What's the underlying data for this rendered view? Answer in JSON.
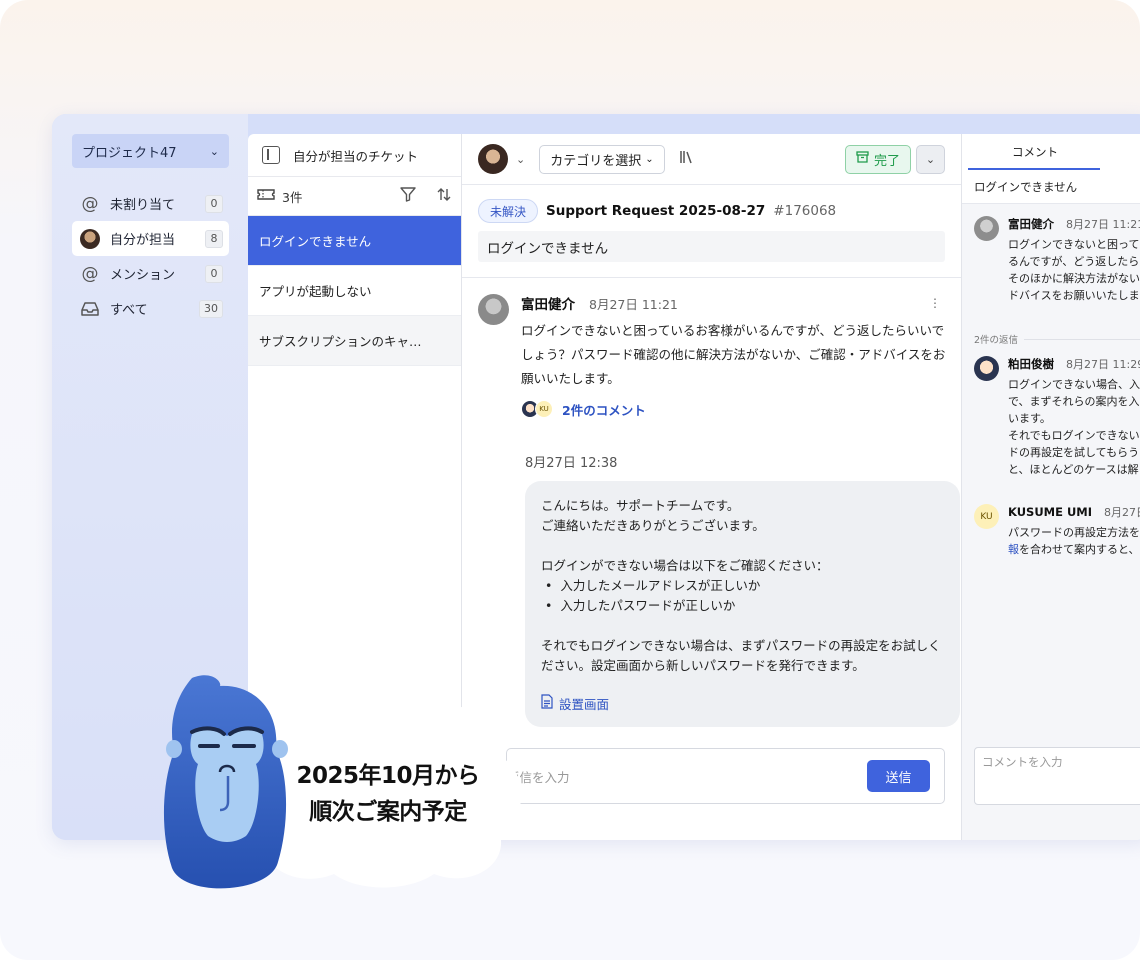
{
  "sidebar": {
    "project": "プロジェクト47",
    "items": [
      {
        "icon": "at-icon",
        "label": "未割り当て",
        "count": "0"
      },
      {
        "icon": "avatar",
        "label": "自分が担当",
        "count": "8"
      },
      {
        "icon": "at-icon",
        "label": "メンション",
        "count": "0"
      },
      {
        "icon": "inbox-icon",
        "label": "すべて",
        "count": "30"
      }
    ]
  },
  "ticket_list": {
    "header": "自分が担当のチケット",
    "count_label": "3件",
    "tickets": [
      "ログインできません",
      "アプリが起動しない",
      "サブスクリプションのキャ…"
    ]
  },
  "toolbar": {
    "category": "カテゴリを選択",
    "done": "完了"
  },
  "ticket": {
    "status": "未解決",
    "title": "Support Request 2025-08-27",
    "id": "#176068",
    "subject": "ログインできません"
  },
  "message": {
    "author": "富田健介",
    "time": "8月27日 11:21",
    "text": "ログインできないと困っているお客様がいるんですが、どう返したらいいでしょう？パスワード確認の他に解決方法がないか、ご確認・アドバイスをお願いいたします。",
    "reply_link": "2件のコメント",
    "mini_avatar_b": "KU"
  },
  "reply": {
    "time": "8月27日 12:38",
    "greeting": "こんにちは。サポートチームです。\nご連絡いただきありがとうございます。",
    "intro": "ログインができない場合は以下をご確認ください：",
    "bullets": [
      "入力したメールアドレスが正しいか",
      "入力したパスワードが正しいか"
    ],
    "closing": "それでもログインできない場合は、まずパスワードの再設定をお試しください。設定画面から新しいパスワードを発行できます。",
    "attachment": "設置画面"
  },
  "composer": {
    "placeholder": "返信を入力",
    "send": "送信"
  },
  "comments": {
    "tab": "コメント",
    "subject": "ログインできません",
    "first": {
      "author": "富田健介",
      "time": "8月27日 11:21",
      "text": "ログインできないと困って\nるんですが、どう返したら\nそのほかに解決方法がない\nドバイスをお願いいたしま"
    },
    "divider": "2件の返信",
    "replies": [
      {
        "author": "粕田俊樹",
        "time": "8月27日 11:29",
        "text": "ログインできない場合、入\nで、まずそれらの案内を入\nいます。\nそれでもログインできない\nドの再設定を試してもらう\nと、ほとんどのケースは解"
      },
      {
        "author": "KUSUME UMI",
        "time": "8月27日 1",
        "avatar": "KU",
        "text_a": "パスワードの再設定方法を",
        "text_link": "報",
        "text_b": "を合わせて案内すると、"
      }
    ],
    "input_placeholder": "コメントを入力"
  },
  "promo": {
    "line1": "2025年10月から",
    "line2": "順次ご案内予定"
  },
  "colors": {
    "accent": "#3f63dd",
    "done_green": "#1f9b4b",
    "sidebar_bg": "#d9e0f8",
    "mascot_blue": "#3a64c8"
  }
}
